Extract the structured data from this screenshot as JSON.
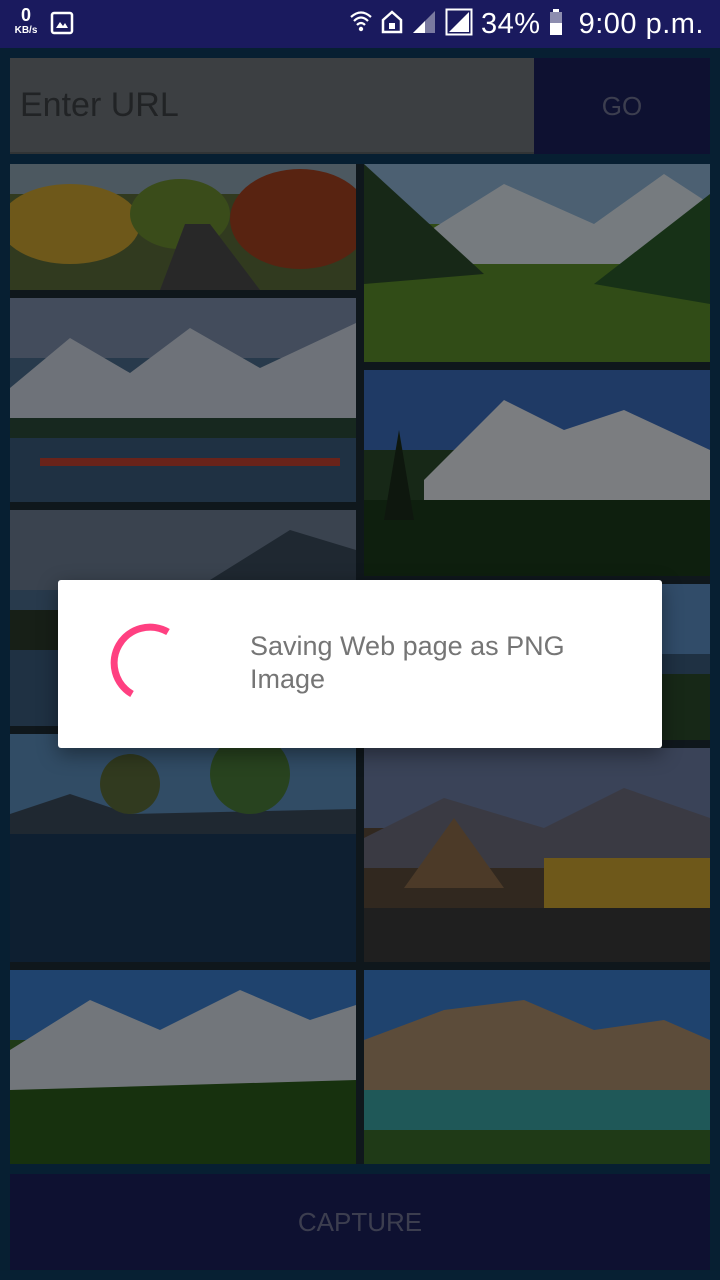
{
  "status_bar": {
    "speed_value": "0",
    "speed_unit": "KB/s",
    "battery_percent": "34%",
    "time": "9:00 p.m.",
    "icons": [
      "image-icon",
      "wifi-icon",
      "home-icon",
      "signal-weak-icon",
      "signal-full-icon",
      "battery-icon"
    ]
  },
  "url_bar": {
    "placeholder": "Enter URL",
    "value": "",
    "go_label": "GO"
  },
  "webview": {
    "content": "gallery of landscape photographs",
    "photos": [
      "photo-autumn-road",
      "photo-green-valley",
      "photo-lake-shikaras",
      "photo-snow-peak-forest",
      "photo-lake-hills",
      "photo-mountain-lake",
      "photo-reflection-lake",
      "photo-monastery",
      "photo-alpine-meadow",
      "photo-turquoise-lake"
    ]
  },
  "capture_label": "CAPTURE",
  "dialog": {
    "message": "Saving Web page as PNG Image"
  },
  "colors": {
    "status_bar": "#1a1a5e",
    "button_bg": "#1a1f5a",
    "spinner": "#ff4081"
  }
}
